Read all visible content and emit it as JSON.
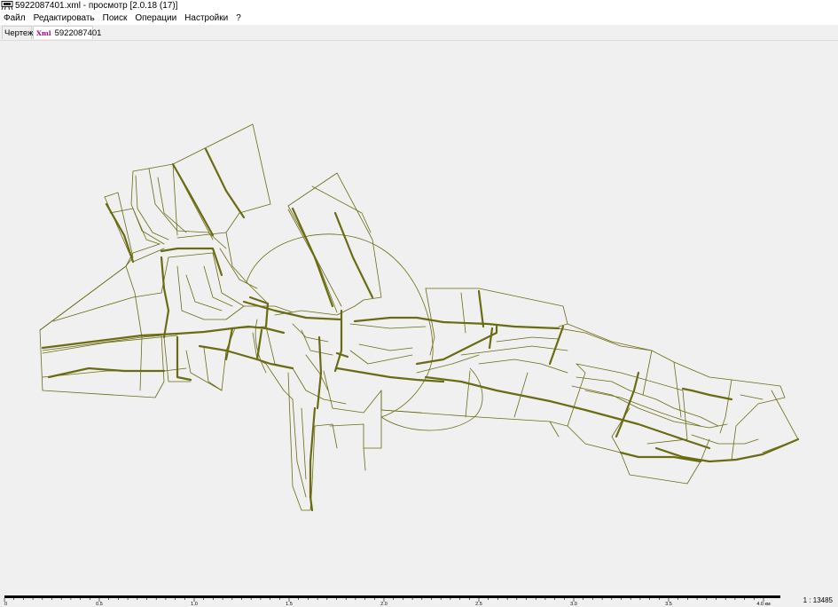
{
  "window": {
    "title": "5922087401.xml - просмотр [2.0.18 (17)]",
    "app_icon": "viewer-app-icon"
  },
  "menu": {
    "items": [
      "Файл",
      "Редактировать",
      "Поиск",
      "Операции",
      "Настройки",
      "?"
    ]
  },
  "tabs": {
    "drawing": "Чертеж",
    "xml": "5922087401",
    "xml_icon_text": "Xml"
  },
  "map": {
    "line_color": "#6b6b14"
  },
  "scale": {
    "ticks": [
      "0",
      "0.5",
      "1.0",
      "1.5",
      "2.0",
      "2.5",
      "3.0",
      "3.5",
      "4.0 км"
    ],
    "ratio": "1 : 13485"
  }
}
